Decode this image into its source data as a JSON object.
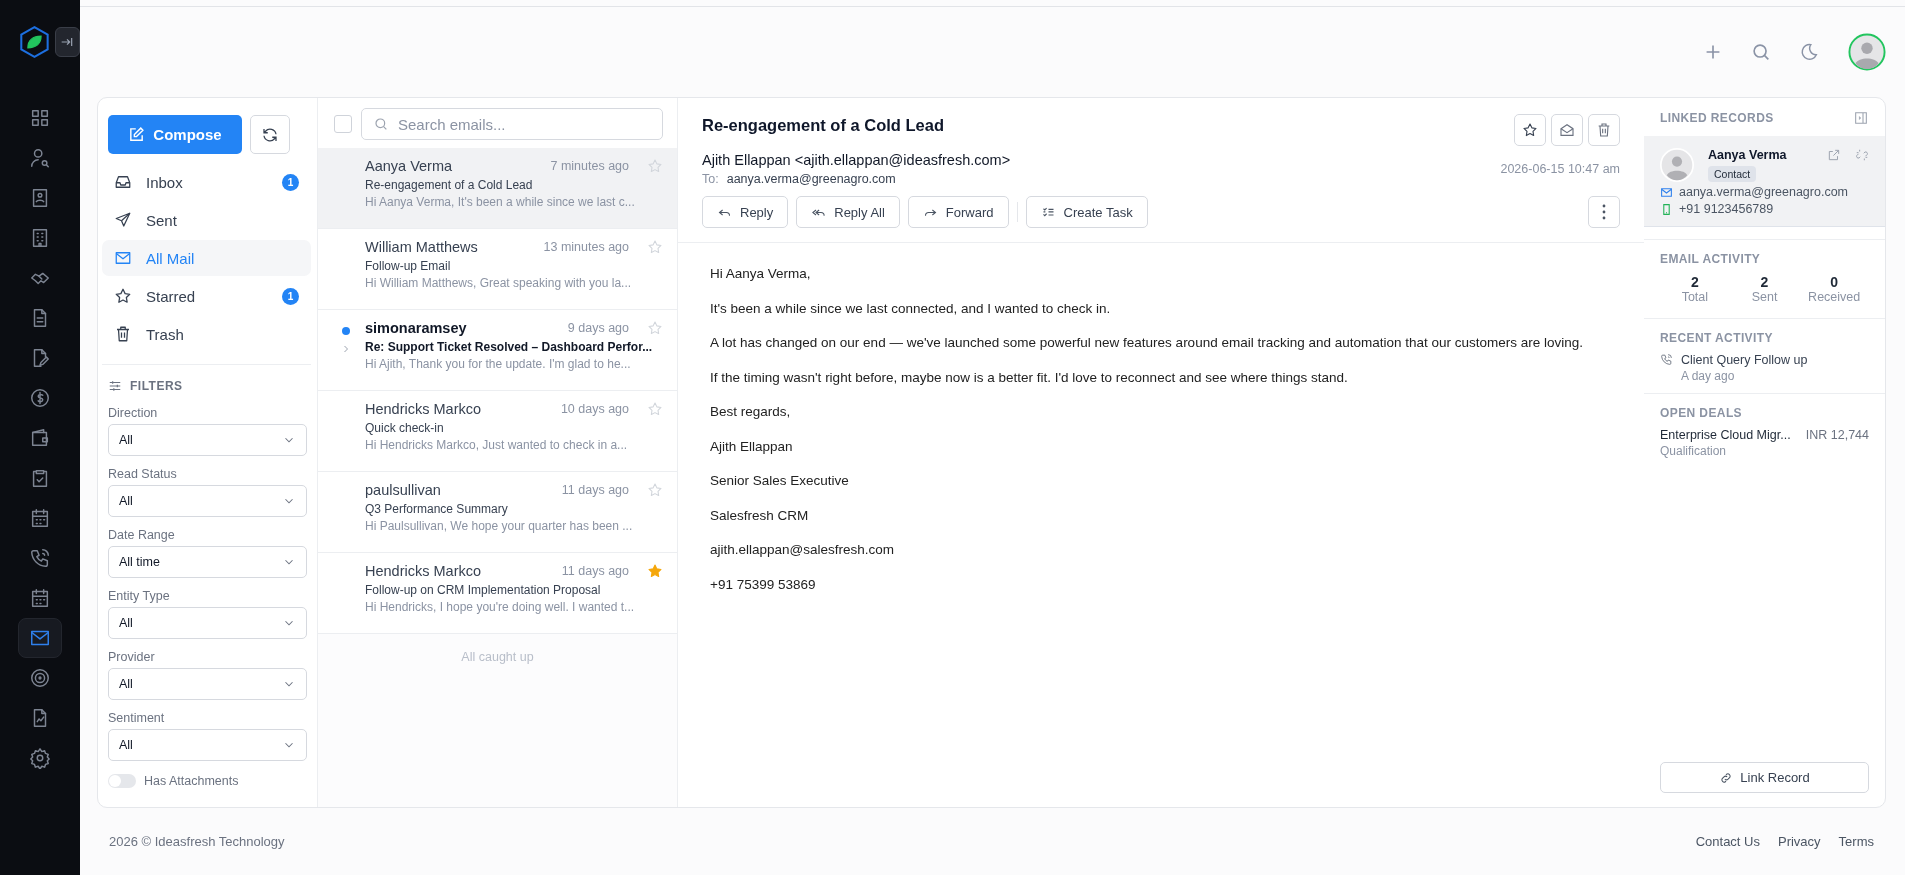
{
  "nav": [
    {
      "selected": false
    },
    {
      "selected": false
    },
    {
      "selected": false
    },
    {
      "selected": false
    },
    {
      "selected": false
    },
    {
      "selected": false
    },
    {
      "selected": false
    },
    {
      "selected": false
    },
    {
      "selected": false
    },
    {
      "selected": false
    },
    {
      "selected": false
    },
    {
      "selected": false
    },
    {
      "selected": false
    },
    {
      "selected": true
    },
    {
      "selected": false
    },
    {
      "selected": false
    },
    {
      "selected": false
    }
  ],
  "compose": "Compose",
  "folders": [
    {
      "label": "Inbox",
      "count": "1",
      "selected": false
    },
    {
      "label": "Sent",
      "selected": false
    },
    {
      "label": "All Mail",
      "selected": true
    },
    {
      "label": "Starred",
      "count": "1",
      "selected": false
    },
    {
      "label": "Trash",
      "selected": false
    }
  ],
  "filters": {
    "title": "FILTERS",
    "fields": [
      {
        "label": "Direction",
        "value": "All"
      },
      {
        "label": "Read Status",
        "value": "All"
      },
      {
        "label": "Date Range",
        "value": "All time"
      },
      {
        "label": "Entity Type",
        "value": "All"
      },
      {
        "label": "Provider",
        "value": "All"
      },
      {
        "label": "Sentiment",
        "value": "All"
      }
    ],
    "toggle": {
      "label": "Has Attachments",
      "on": false
    }
  },
  "list": {
    "select_all": false,
    "search_placeholder": "Search emails...",
    "end_note": "All caught up",
    "emails": [
      {
        "sender": "Aanya Verma",
        "time": "7 minutes ago",
        "subject": "Re-engagement of a Cold Lead",
        "preview": "Hi Aanya Verma, It's been a while since we last c...",
        "starred": false,
        "unread": false,
        "thread": false,
        "selected": true
      },
      {
        "sender": "William Matthews",
        "time": "13 minutes ago",
        "subject": "Follow-up Email",
        "preview": "Hi William Matthews, Great speaking with you la...",
        "starred": false,
        "unread": false,
        "thread": false,
        "selected": false
      },
      {
        "sender": "simonaramsey",
        "time": "9 days ago",
        "subject": "Re: Support Ticket Resolved – Dashboard Perfor...",
        "preview": "Hi Ajith, Thank you for the update. I'm glad to he...",
        "starred": false,
        "unread": true,
        "thread": true,
        "selected": false
      },
      {
        "sender": "Hendricks Markco",
        "time": "10 days ago",
        "subject": "Quick check-in",
        "preview": "Hi Hendricks Markco, Just wanted to check in a...",
        "starred": false,
        "unread": false,
        "thread": false,
        "selected": false
      },
      {
        "sender": "paulsullivan",
        "time": "11 days ago",
        "subject": "Q3 Performance Summary",
        "preview": "Hi Paulsullivan, We hope your quarter has been ...",
        "starred": false,
        "unread": false,
        "thread": false,
        "selected": false
      },
      {
        "sender": "Hendricks Markco",
        "time": "11 days ago",
        "subject": "Follow-up on CRM Implementation Proposal",
        "preview": "Hi Hendricks, I hope you're doing well. I wanted t...",
        "starred": true,
        "unread": false,
        "thread": false,
        "selected": false
      }
    ]
  },
  "message": {
    "subject": "Re-engagement of a Cold Lead",
    "from": "Ajith Ellappan <ajith.ellappan@ideasfresh.com>",
    "to_label": "To:",
    "to": "aanya.verma@greenagro.com",
    "date": "2026-06-15 10:47 am",
    "actions": [
      {
        "kind": "reply",
        "label": "Reply"
      },
      {
        "kind": "reply-all",
        "label": "Reply All"
      },
      {
        "kind": "forward",
        "label": "Forward"
      },
      {
        "kind": "task",
        "label": "Create Task"
      }
    ],
    "body": [
      "Hi Aanya Verma,",
      "It's been a while since we last connected, and I wanted to check in.",
      "A lot has changed on our end — we've launched some powerful new features around email tracking and automation that our customers are loving.",
      "If the timing wasn't right before, maybe now is a better fit. I'd love to reconnect and see where things stand.",
      "Best regards,",
      "Ajith Ellappan",
      "Senior Sales Executive",
      "Salesfresh CRM",
      "ajith.ellappan@salesfresh.com",
      "+91 75399 53869"
    ]
  },
  "linked": {
    "title": "LINKED RECORDS",
    "contact": {
      "name": "Aanya Verma",
      "tag": "Contact",
      "email": "aanya.verma@greenagro.com",
      "phone": "+91 9123456789"
    },
    "activity": {
      "title": "EMAIL ACTIVITY",
      "stats": [
        {
          "value": "2",
          "label": "Total"
        },
        {
          "value": "2",
          "label": "Sent"
        },
        {
          "value": "0",
          "label": "Received"
        }
      ]
    },
    "recent": {
      "title": "RECENT ACTIVITY",
      "items": [
        {
          "title": "Client Query Follow up",
          "time": "A day ago"
        }
      ]
    },
    "deals": {
      "title": "OPEN DEALS",
      "items": [
        {
          "name": "Enterprise Cloud Migr...",
          "amount": "INR 12,744",
          "stage": "Qualification"
        }
      ]
    },
    "link_button": "Link Record"
  },
  "footer": {
    "copyright": "2026 ©  Ideasfresh Technology",
    "links": [
      "Contact Us",
      "Privacy",
      "Terms"
    ]
  }
}
